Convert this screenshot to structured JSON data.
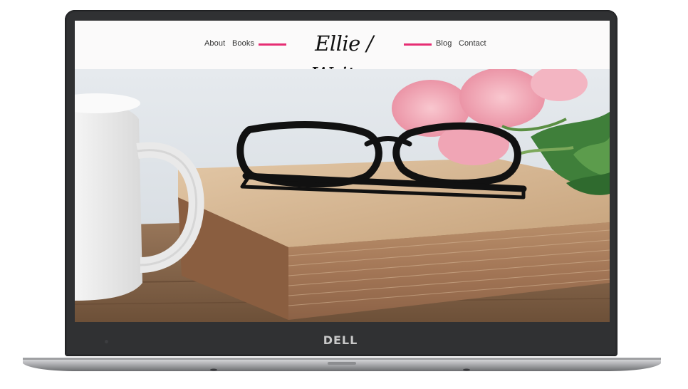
{
  "header": {
    "nav_left": [
      {
        "label": "About"
      },
      {
        "label": "Books"
      }
    ],
    "logo_text": "Ellie / Writes",
    "nav_right": [
      {
        "label": "Blog"
      },
      {
        "label": "Contact"
      }
    ]
  },
  "device": {
    "brand_label": "DELL"
  },
  "colors": {
    "accent": "#e62d73",
    "bezel": "#2b2c2e",
    "header_bg": "#fbfafa",
    "nav_text": "#333333",
    "logo_text": "#111111"
  },
  "hero": {
    "icon": "hero-photo-glasses-book-cup-roses"
  }
}
